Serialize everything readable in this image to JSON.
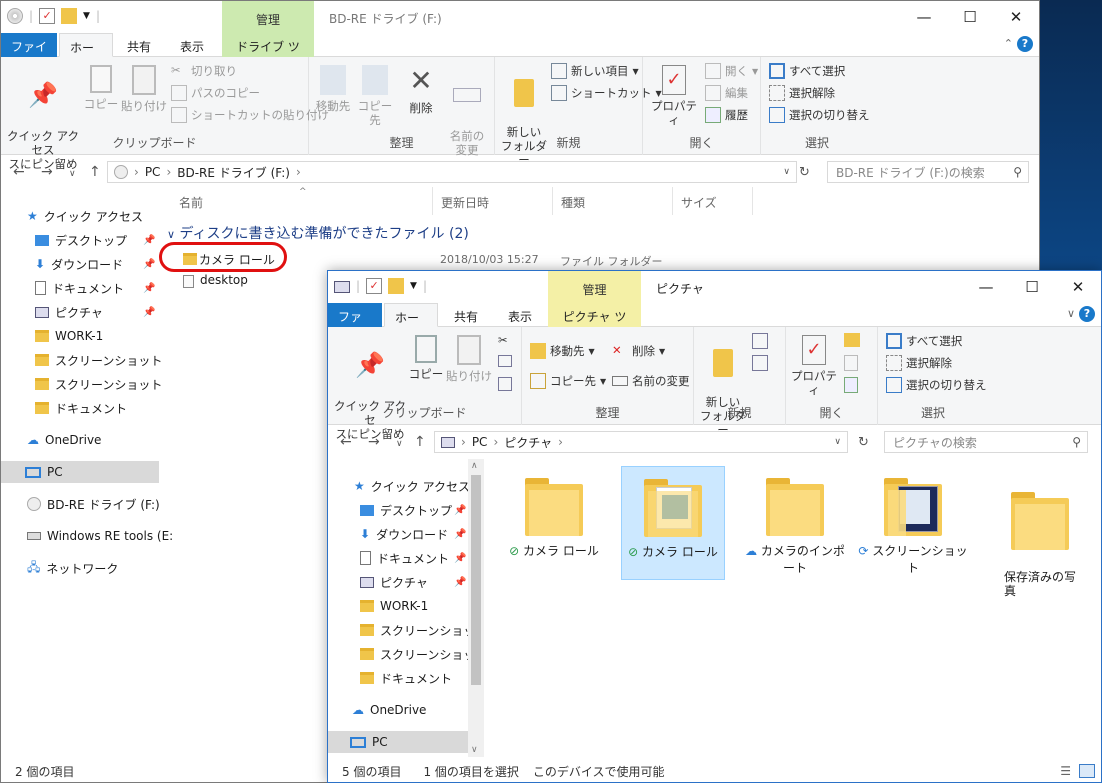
{
  "win1": {
    "title": "BD-RE ドライブ (F:)",
    "context_tab": "管理",
    "tabs": [
      "ファイル",
      "ホーム",
      "共有",
      "表示",
      "ドライブ ツール"
    ],
    "ribbon": {
      "pin_label": "クイック アクセス\nスにピン留め",
      "copy": "コピー",
      "paste": "貼り付け",
      "cut": "切り取り",
      "copy_path": "パスのコピー",
      "paste_shortcut": "ショートカットの貼り付け",
      "clipboard_group": "クリップボード",
      "move_to": "移動先",
      "copy_to": "コピー先",
      "delete": "削除",
      "rename": "名前の\n変更",
      "organize_group": "整理",
      "new_folder": "新しい\nフォルダー",
      "new_item": "新しい項目",
      "shortcut": "ショートカット",
      "new_group": "新規",
      "properties": "プロパティ",
      "open": "開く",
      "edit": "編集",
      "history": "履歴",
      "open_group": "開く",
      "select_all": "すべて選択",
      "select_none": "選択解除",
      "invert_selection": "選択の切り替え",
      "select_group": "選択"
    },
    "breadcrumb": [
      "PC",
      "BD-RE ドライブ (F:)"
    ],
    "search_placeholder": "BD-RE ドライブ (F:)の検索",
    "columns": [
      "名前",
      "更新日時",
      "種類",
      "サイズ"
    ],
    "group_header": "ディスクに書き込む準備ができたファイル (2)",
    "files": [
      {
        "name": "カメラ ロール",
        "date": "2018/10/03 15:27",
        "type": "ファイル フォルダー"
      },
      {
        "name": "desktop",
        "date": "",
        "type": ""
      }
    ],
    "nav": {
      "quick_access": "クイック アクセス",
      "items": [
        "デスクトップ",
        "ダウンロード",
        "ドキュメント",
        "ピクチャ",
        "WORK-1",
        "スクリーンショット",
        "スクリーンショット",
        "ドキュメント"
      ],
      "onedrive": "OneDrive",
      "pc": "PC",
      "bdre": "BD-RE ドライブ (F:)",
      "winre": "Windows RE tools (E:",
      "network": "ネットワーク"
    },
    "status": "2 個の項目"
  },
  "win2": {
    "title": "ピクチャ",
    "context_tab": "管理",
    "tabs": [
      "ファイル",
      "ホーム",
      "共有",
      "表示",
      "ピクチャ ツール"
    ],
    "ribbon": {
      "pin_label": "クイック アクセ\nスにピン留め",
      "copy": "コピー",
      "paste": "貼り付け",
      "clipboard_group": "クリップボード",
      "move_to": "移動先",
      "copy_to": "コピー先",
      "delete": "削除",
      "rename": "名前の変更",
      "organize_group": "整理",
      "new_folder": "新しい\nフォルダー",
      "new_group": "新規",
      "properties": "プロパティ",
      "open_group": "開く",
      "select_all": "すべて選択",
      "select_none": "選択解除",
      "invert_selection": "選択の切り替え",
      "select_group": "選択"
    },
    "breadcrumb": [
      "PC",
      "ピクチャ"
    ],
    "search_placeholder": "ピクチャの検索",
    "nav": {
      "quick_access": "クイック アクセス",
      "items": [
        "デスクトップ",
        "ダウンロード",
        "ドキュメント",
        "ピクチャ",
        "WORK-1",
        "スクリーンショット",
        "スクリーンショット",
        "ドキュメント"
      ],
      "onedrive": "OneDrive",
      "pc": "PC"
    },
    "tiles": [
      "カメラ ロール",
      "カメラ ロール",
      "カメラのインポート",
      "スクリーンショット",
      "保存済みの写\n真"
    ],
    "status": [
      "5 個の項目",
      "1 個の項目を選択",
      "このデバイスで使用可能"
    ]
  },
  "colors": {
    "accent": "#1979ca",
    "context_tab": "#cdeab0",
    "highlight_ring": "#e01010",
    "selection": "#cce8ff"
  }
}
